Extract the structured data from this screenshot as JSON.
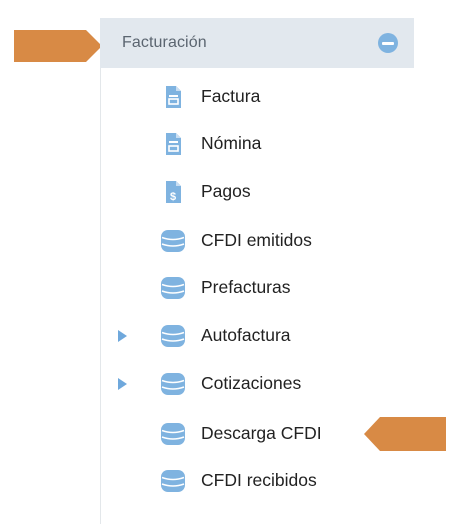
{
  "section": {
    "title": "Facturación",
    "collapse_icon": "minus-circle-icon"
  },
  "items": [
    {
      "label": "Factura",
      "icon": "invoice-document-icon",
      "expandable": false
    },
    {
      "label": "Nómina",
      "icon": "payroll-document-icon",
      "expandable": false
    },
    {
      "label": "Pagos",
      "icon": "payment-document-icon",
      "expandable": false
    },
    {
      "label": "CFDI emitidos",
      "icon": "database-icon",
      "expandable": false
    },
    {
      "label": "Prefacturas",
      "icon": "database-icon",
      "expandable": false
    },
    {
      "label": "Autofactura",
      "icon": "database-icon",
      "expandable": true
    },
    {
      "label": "Cotizaciones",
      "icon": "database-icon",
      "expandable": true
    },
    {
      "label": "Descarga CFDI",
      "icon": "database-icon",
      "expandable": false
    },
    {
      "label": "CFDI recibidos",
      "icon": "database-icon",
      "expandable": false
    }
  ],
  "colors": {
    "header_bg": "#e2e8ee",
    "accent_blue": "#7fb3e0",
    "pointer_orange": "#d88a45"
  }
}
